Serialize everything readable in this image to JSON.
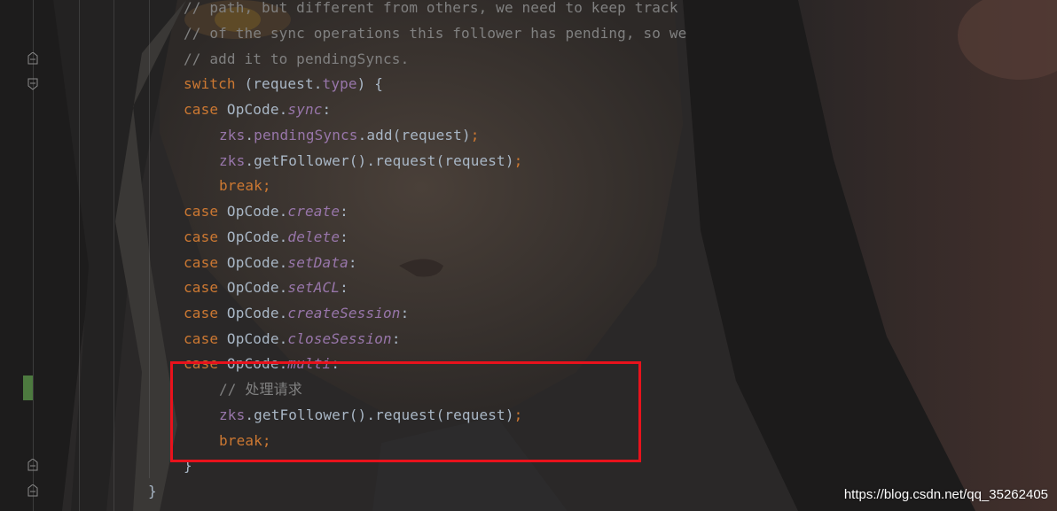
{
  "editor": {
    "lines": [
      [
        {
          "t": "comment",
          "v": "// path, but different from others, we need to keep track"
        }
      ],
      [
        {
          "t": "comment",
          "v": "// of the sync operations this follower has pending, so we"
        }
      ],
      [
        {
          "t": "comment",
          "v": "// add it to pendingSyncs."
        }
      ],
      [
        {
          "t": "keyword",
          "v": "switch"
        },
        {
          "t": "plain",
          "v": " (request."
        },
        {
          "t": "field",
          "v": "type"
        },
        {
          "t": "plain",
          "v": ") {"
        }
      ],
      [
        {
          "t": "keyword",
          "v": "case"
        },
        {
          "t": "plain",
          "v": " OpCode."
        },
        {
          "t": "const",
          "v": "sync"
        },
        {
          "t": "plain",
          "v": ":"
        }
      ],
      [
        {
          "t": "field",
          "v": "zks"
        },
        {
          "t": "plain",
          "v": "."
        },
        {
          "t": "field",
          "v": "pendingSyncs"
        },
        {
          "t": "plain",
          "v": ".add(request)"
        },
        {
          "t": "punct",
          "v": ";"
        }
      ],
      [
        {
          "t": "field",
          "v": "zks"
        },
        {
          "t": "plain",
          "v": ".getFollower().request(request)"
        },
        {
          "t": "punct",
          "v": ";"
        }
      ],
      [
        {
          "t": "keyword",
          "v": "break;"
        }
      ],
      [
        {
          "t": "keyword",
          "v": "case"
        },
        {
          "t": "plain",
          "v": " OpCode."
        },
        {
          "t": "const",
          "v": "create"
        },
        {
          "t": "plain",
          "v": ":"
        }
      ],
      [
        {
          "t": "keyword",
          "v": "case"
        },
        {
          "t": "plain",
          "v": " OpCode."
        },
        {
          "t": "const",
          "v": "delete"
        },
        {
          "t": "plain",
          "v": ":"
        }
      ],
      [
        {
          "t": "keyword",
          "v": "case"
        },
        {
          "t": "plain",
          "v": " OpCode."
        },
        {
          "t": "const",
          "v": "setData"
        },
        {
          "t": "plain",
          "v": ":"
        }
      ],
      [
        {
          "t": "keyword",
          "v": "case"
        },
        {
          "t": "plain",
          "v": " OpCode."
        },
        {
          "t": "const",
          "v": "setACL"
        },
        {
          "t": "plain",
          "v": ":"
        }
      ],
      [
        {
          "t": "keyword",
          "v": "case"
        },
        {
          "t": "plain",
          "v": " OpCode."
        },
        {
          "t": "const",
          "v": "createSession"
        },
        {
          "t": "plain",
          "v": ":"
        }
      ],
      [
        {
          "t": "keyword",
          "v": "case"
        },
        {
          "t": "plain",
          "v": " OpCode."
        },
        {
          "t": "const",
          "v": "closeSession"
        },
        {
          "t": "plain",
          "v": ":"
        }
      ],
      [
        {
          "t": "keyword",
          "v": "case"
        },
        {
          "t": "plain",
          "v": " OpCode."
        },
        {
          "t": "const",
          "v": "multi"
        },
        {
          "t": "plain",
          "v": ":"
        }
      ],
      [
        {
          "t": "comment",
          "v": "// 处理请求"
        }
      ],
      [
        {
          "t": "field",
          "v": "zks"
        },
        {
          "t": "plain",
          "v": ".getFollower().request(request)"
        },
        {
          "t": "punct",
          "v": ";"
        }
      ],
      [
        {
          "t": "keyword",
          "v": "break;"
        }
      ],
      [
        {
          "t": "plain",
          "v": "}"
        }
      ],
      [
        {
          "t": "plain",
          "v": "}"
        }
      ]
    ]
  },
  "icons": {
    "fold": "fold-marker-icon"
  },
  "colors": {
    "highlight_border": "#e8121c",
    "keyword": "#cc7832",
    "comment": "#808080",
    "field": "#9876aa",
    "plain": "#a9b7c6"
  },
  "watermark": {
    "text": "https://blog.csdn.net/qq_35262405"
  }
}
